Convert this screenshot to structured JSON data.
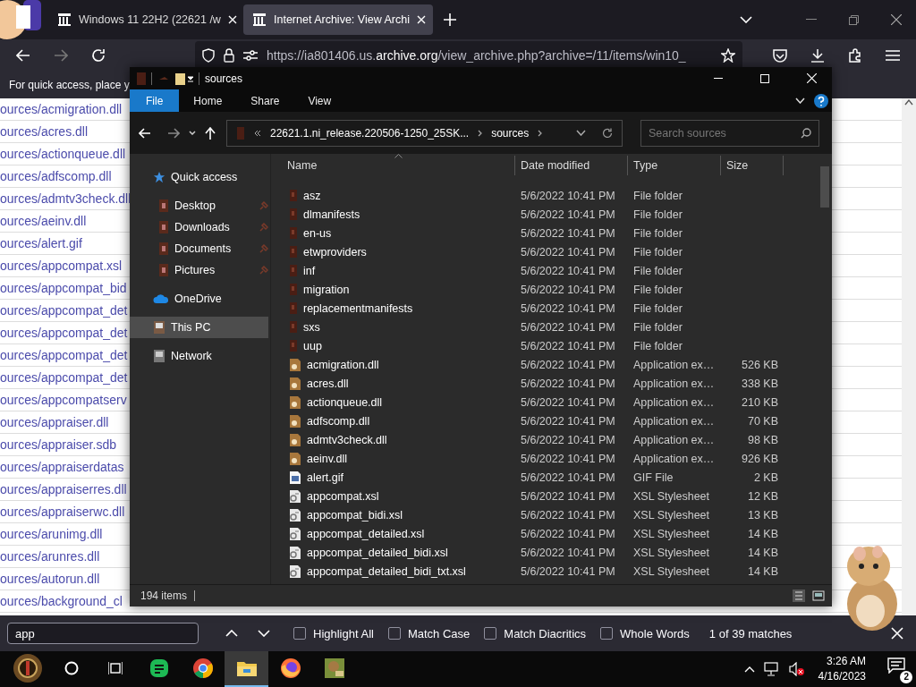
{
  "browser": {
    "tabs": [
      {
        "title": "Windows 11 22H2 (22621 /w",
        "selected": false
      },
      {
        "title": "Internet Archive: View Archi",
        "selected": true
      }
    ],
    "url": "https://ia801406.us.**archive.org**/view_archive.php?archive=/11/items/win10_",
    "bookmarks_hint": "For quick access, place y"
  },
  "page_links": [
    "ources/acmigration.dll",
    "ources/acres.dll",
    "ources/actionqueue.dll",
    "ources/adfscomp.dll",
    "ources/admtv3check.dll",
    "ources/aeinv.dll",
    "ources/alert.gif",
    "ources/appcompat.xsl",
    "ources/appcompat_bid",
    "ources/appcompat_det",
    "ources/appcompat_det",
    "ources/appcompat_det",
    "ources/appcompat_det",
    "ources/appcompatserv",
    "ources/appraiser.dll",
    "ources/appraiser.sdb",
    "ources/appraiserdatas",
    "ources/appraiserres.dll",
    "ources/appraiserwc.dll",
    "ources/arunimg.dll",
    "ources/arunres.dll",
    "ources/autorun.dll",
    "ources/background_cl"
  ],
  "explorer": {
    "title": "sources",
    "ribbon_tabs": [
      {
        "label": "File",
        "selected": true
      },
      {
        "label": "Home",
        "selected": false
      },
      {
        "label": "Share",
        "selected": false
      },
      {
        "label": "View",
        "selected": false
      }
    ],
    "breadcrumb": [
      "22621.1.ni_release.220506-1250_25SK...",
      "sources"
    ],
    "search": {
      "placeholder": "Search sources"
    },
    "nav": [
      {
        "label": "Quick access",
        "kind": "star",
        "selected": false,
        "children": [
          {
            "label": "Desktop",
            "kind": "folder",
            "pinned": true,
            "selected": false
          },
          {
            "label": "Downloads",
            "kind": "folder",
            "pinned": true,
            "selected": false
          },
          {
            "label": "Documents",
            "kind": "folder",
            "pinned": true,
            "selected": false
          },
          {
            "label": "Pictures",
            "kind": "folder",
            "pinned": true,
            "selected": false
          }
        ]
      },
      {
        "label": "OneDrive",
        "kind": "cloud",
        "selected": false
      },
      {
        "label": "This PC",
        "kind": "pc",
        "selected": true
      },
      {
        "label": "Network",
        "kind": "network",
        "selected": false
      }
    ],
    "columns": [
      "Name",
      "Date modified",
      "Type",
      "Size"
    ],
    "files": [
      {
        "kind": "folder",
        "name": "asz",
        "date": "5/6/2022 10:41 PM",
        "type": "File folder"
      },
      {
        "kind": "folder",
        "name": "dlmanifests",
        "date": "5/6/2022 10:41 PM",
        "type": "File folder"
      },
      {
        "kind": "folder",
        "name": "en-us",
        "date": "5/6/2022 10:41 PM",
        "type": "File folder"
      },
      {
        "kind": "folder",
        "name": "etwproviders",
        "date": "5/6/2022 10:41 PM",
        "type": "File folder"
      },
      {
        "kind": "folder",
        "name": "inf",
        "date": "5/6/2022 10:41 PM",
        "type": "File folder"
      },
      {
        "kind": "folder",
        "name": "migration",
        "date": "5/6/2022 10:41 PM",
        "type": "File folder"
      },
      {
        "kind": "folder",
        "name": "replacementmanifests",
        "date": "5/6/2022 10:41 PM",
        "type": "File folder"
      },
      {
        "kind": "folder",
        "name": "sxs",
        "date": "5/6/2022 10:41 PM",
        "type": "File folder"
      },
      {
        "kind": "folder",
        "name": "uup",
        "date": "5/6/2022 10:41 PM",
        "type": "File folder"
      },
      {
        "kind": "dll",
        "name": "acmigration.dll",
        "date": "5/6/2022 10:41 PM",
        "type": "Application ex…",
        "size": "526 KB"
      },
      {
        "kind": "dll",
        "name": "acres.dll",
        "date": "5/6/2022 10:41 PM",
        "type": "Application ex…",
        "size": "338 KB"
      },
      {
        "kind": "dll",
        "name": "actionqueue.dll",
        "date": "5/6/2022 10:41 PM",
        "type": "Application ex…",
        "size": "210 KB"
      },
      {
        "kind": "dll",
        "name": "adfscomp.dll",
        "date": "5/6/2022 10:41 PM",
        "type": "Application ex…",
        "size": "70 KB"
      },
      {
        "kind": "dll",
        "name": "admtv3check.dll",
        "date": "5/6/2022 10:41 PM",
        "type": "Application ex…",
        "size": "98 KB"
      },
      {
        "kind": "dll",
        "name": "aeinv.dll",
        "date": "5/6/2022 10:41 PM",
        "type": "Application ex…",
        "size": "926 KB"
      },
      {
        "kind": "gif",
        "name": "alert.gif",
        "date": "5/6/2022 10:41 PM",
        "type": "GIF File",
        "size": "2 KB"
      },
      {
        "kind": "xsl",
        "name": "appcompat.xsl",
        "date": "5/6/2022 10:41 PM",
        "type": "XSL Stylesheet",
        "size": "12 KB"
      },
      {
        "kind": "xsl",
        "name": "appcompat_bidi.xsl",
        "date": "5/6/2022 10:41 PM",
        "type": "XSL Stylesheet",
        "size": "13 KB"
      },
      {
        "kind": "xsl",
        "name": "appcompat_detailed.xsl",
        "date": "5/6/2022 10:41 PM",
        "type": "XSL Stylesheet",
        "size": "14 KB"
      },
      {
        "kind": "xsl",
        "name": "appcompat_detailed_bidi.xsl",
        "date": "5/6/2022 10:41 PM",
        "type": "XSL Stylesheet",
        "size": "14 KB"
      },
      {
        "kind": "xsl",
        "name": "appcompat_detailed_bidi_txt.xsl",
        "date": "5/6/2022 10:41 PM",
        "type": "XSL Stylesheet",
        "size": "14 KB"
      }
    ],
    "status": "194 items"
  },
  "find_bar": {
    "value": "app",
    "options": [
      {
        "label": "Highlight All",
        "checked": false
      },
      {
        "label": "Match Case",
        "checked": false
      },
      {
        "label": "Match Diacritics",
        "checked": false
      },
      {
        "label": "Whole Words",
        "checked": false
      }
    ],
    "result": "1 of 39 matches"
  },
  "taskbar": {
    "apps": [
      {
        "kind": "start",
        "active": false
      },
      {
        "kind": "search",
        "active": false
      },
      {
        "kind": "taskview",
        "active": false
      },
      {
        "kind": "green",
        "active": false
      },
      {
        "kind": "chrome",
        "active": false
      },
      {
        "kind": "explorer",
        "active": true
      },
      {
        "kind": "firefox",
        "active": false
      },
      {
        "kind": "box",
        "active": false
      }
    ],
    "time": "3:26 AM",
    "date": "4/16/2023",
    "notifications": "2"
  }
}
